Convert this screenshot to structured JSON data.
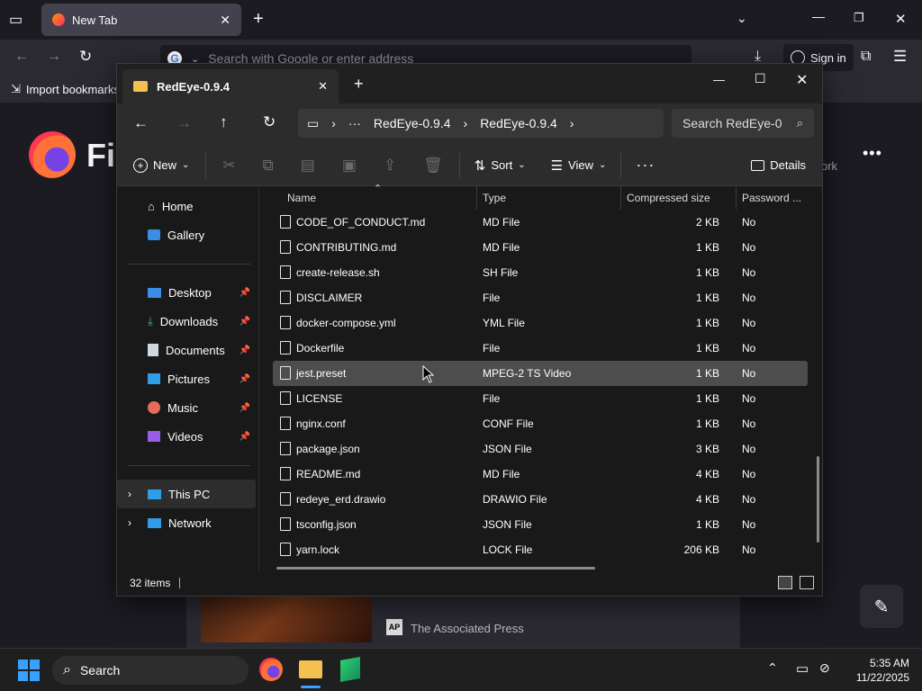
{
  "firefox": {
    "tab_title": "New Tab",
    "url_placeholder": "Search with Google or enter address",
    "sign_in": "Sign in",
    "bookmarks_import": "Import bookmarks",
    "logo_text": "Fi",
    "story_source": "The Associated Press",
    "right_partial": "ork"
  },
  "explorer": {
    "tab_title": "RedEye-0.9.4",
    "breadcrumbs": [
      "RedEye-0.9.4",
      "RedEye-0.9.4"
    ],
    "search_placeholder": "Search RedEye-0",
    "toolbar": {
      "new_label": "New",
      "sort_label": "Sort",
      "view_label": "View",
      "details_label": "Details"
    },
    "nav": {
      "home": "Home",
      "gallery": "Gallery",
      "desktop": "Desktop",
      "downloads": "Downloads",
      "documents": "Documents",
      "pictures": "Pictures",
      "music": "Music",
      "videos": "Videos",
      "this_pc": "This PC",
      "network": "Network"
    },
    "columns": {
      "name": "Name",
      "type": "Type",
      "compressed_size": "Compressed size",
      "password": "Password ..."
    },
    "files": [
      {
        "name": "CODE_OF_CONDUCT.md",
        "type": "MD File",
        "size": "2 KB",
        "password": "No"
      },
      {
        "name": "CONTRIBUTING.md",
        "type": "MD File",
        "size": "1 KB",
        "password": "No"
      },
      {
        "name": "create-release.sh",
        "type": "SH File",
        "size": "1 KB",
        "password": "No"
      },
      {
        "name": "DISCLAIMER",
        "type": "File",
        "size": "1 KB",
        "password": "No"
      },
      {
        "name": "docker-compose.yml",
        "type": "YML File",
        "size": "1 KB",
        "password": "No"
      },
      {
        "name": "Dockerfile",
        "type": "File",
        "size": "1 KB",
        "password": "No"
      },
      {
        "name": "jest.preset",
        "type": "MPEG-2 TS Video",
        "size": "1 KB",
        "password": "No"
      },
      {
        "name": "LICENSE",
        "type": "File",
        "size": "1 KB",
        "password": "No"
      },
      {
        "name": "nginx.conf",
        "type": "CONF File",
        "size": "1 KB",
        "password": "No"
      },
      {
        "name": "package.json",
        "type": "JSON File",
        "size": "3 KB",
        "password": "No"
      },
      {
        "name": "README.md",
        "type": "MD File",
        "size": "4 KB",
        "password": "No"
      },
      {
        "name": "redeye_erd.drawio",
        "type": "DRAWIO File",
        "size": "4 KB",
        "password": "No"
      },
      {
        "name": "tsconfig.json",
        "type": "JSON File",
        "size": "1 KB",
        "password": "No"
      },
      {
        "name": "yarn.lock",
        "type": "LOCK File",
        "size": "206 KB",
        "password": "No"
      }
    ],
    "status_count": "32 items"
  },
  "taskbar": {
    "search_label": "Search",
    "time": "5:35 AM",
    "date": "11/22/2025"
  },
  "colors": {
    "firefox_bg": "#1c1b22",
    "explorer_bg": "#191919",
    "selection": "#4d4d4d",
    "folder": "#f2c14e",
    "accent": "#0078d4"
  }
}
